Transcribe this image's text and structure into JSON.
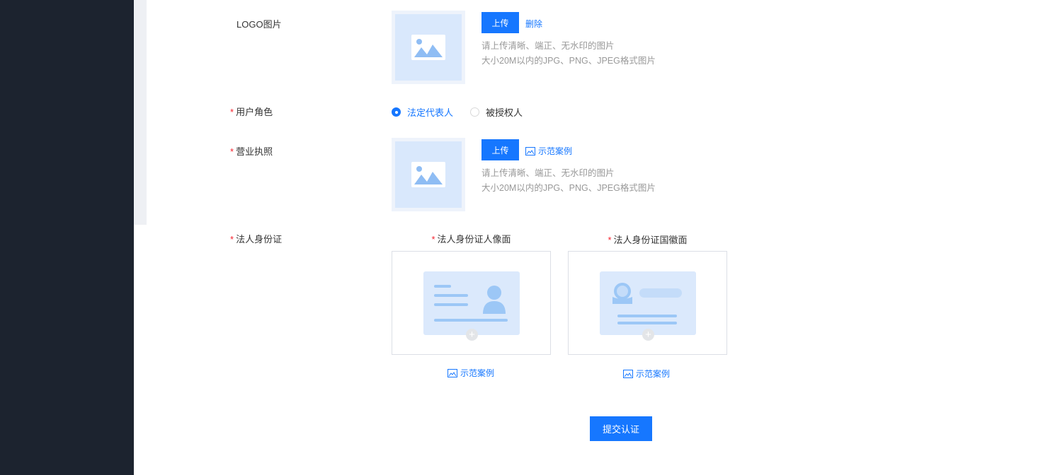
{
  "form": {
    "logo": {
      "label": "LOGO图片",
      "upload_label": "上传",
      "delete_label": "删除",
      "hint_line1": "请上传清晰、端正、无水印的图片",
      "hint_line2": "大小20M以内的JPG、PNG、JPEG格式图片"
    },
    "role": {
      "required_mark": "*",
      "label": "用户角色",
      "options": [
        {
          "label": "法定代表人",
          "selected": true
        },
        {
          "label": "被授权人",
          "selected": false
        }
      ]
    },
    "license": {
      "required_mark": "*",
      "label": "营业执照",
      "upload_label": "上传",
      "example_label": "示范案例",
      "hint_line1": "请上传清晰、端正、无水印的图片",
      "hint_line2": "大小20M以内的JPG、PNG、JPEG格式图片"
    },
    "id_card": {
      "required_mark": "*",
      "label": "法人身份证",
      "front": {
        "required_mark": "*",
        "title": "法人身份证人像面",
        "example_label": "示范案例"
      },
      "back": {
        "required_mark": "*",
        "title": "法人身份证国徽面",
        "example_label": "示范案例"
      }
    },
    "submit_label": "提交认证"
  },
  "colors": {
    "primary": "#1677ff",
    "sidebar_bg": "#1c232f",
    "required": "#f5222d",
    "placeholder_fill": "#d9e8fc",
    "hint_text": "#999999"
  },
  "icons": [
    "image-placeholder-icon",
    "example-image-icon",
    "id-portrait-icon",
    "id-emblem-icon",
    "plus-icon"
  ]
}
